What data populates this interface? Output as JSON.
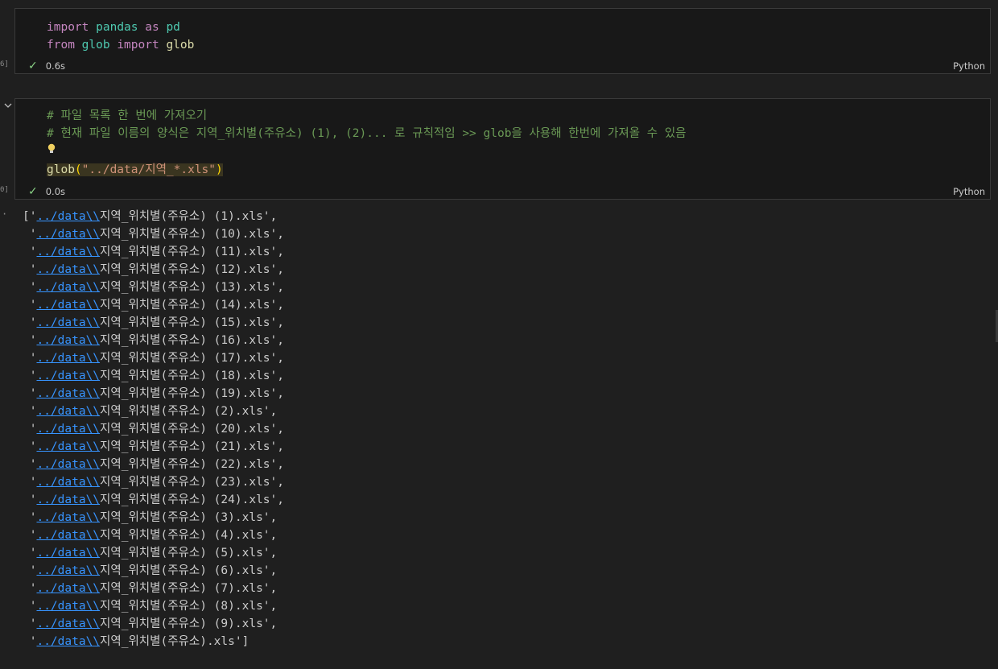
{
  "cell1": {
    "exec_count": "6]",
    "lines": [
      {
        "kw1": "import",
        "mod": "pandas",
        "kw2": "as",
        "alias": "pd"
      },
      {
        "kw1": "from",
        "mod": "glob",
        "kw2": "import",
        "alias": "glob"
      }
    ],
    "time": "0.6s",
    "language": "Python"
  },
  "cell2": {
    "exec_count": "0]",
    "comment1": "# 파일 목록 한 번에 가져오기",
    "comment2": "# 현재 파일 이름의 양식은 지역_위치별(주유소) (1), (2)... 로 규칙적임 >> glob을 사용해 한번에 가져올 수 있음",
    "call_fn": "glob",
    "call_arg": "\"../data/지역_*.xls\"",
    "time": "0.0s",
    "language": "Python"
  },
  "output": {
    "link_text": "../data\\\\",
    "files": [
      "지역_위치별(주유소) (1).xls",
      "지역_위치별(주유소) (10).xls",
      "지역_위치별(주유소) (11).xls",
      "지역_위치별(주유소) (12).xls",
      "지역_위치별(주유소) (13).xls",
      "지역_위치별(주유소) (14).xls",
      "지역_위치별(주유소) (15).xls",
      "지역_위치별(주유소) (16).xls",
      "지역_위치별(주유소) (17).xls",
      "지역_위치별(주유소) (18).xls",
      "지역_위치별(주유소) (19).xls",
      "지역_위치별(주유소) (2).xls",
      "지역_위치별(주유소) (20).xls",
      "지역_위치별(주유소) (21).xls",
      "지역_위치별(주유소) (22).xls",
      "지역_위치별(주유소) (23).xls",
      "지역_위치별(주유소) (24).xls",
      "지역_위치별(주유소) (3).xls",
      "지역_위치별(주유소) (4).xls",
      "지역_위치별(주유소) (5).xls",
      "지역_위치별(주유소) (6).xls",
      "지역_위치별(주유소) (7).xls",
      "지역_위치별(주유소) (8).xls",
      "지역_위치별(주유소) (9).xls",
      "지역_위치별(주유소).xls"
    ]
  }
}
